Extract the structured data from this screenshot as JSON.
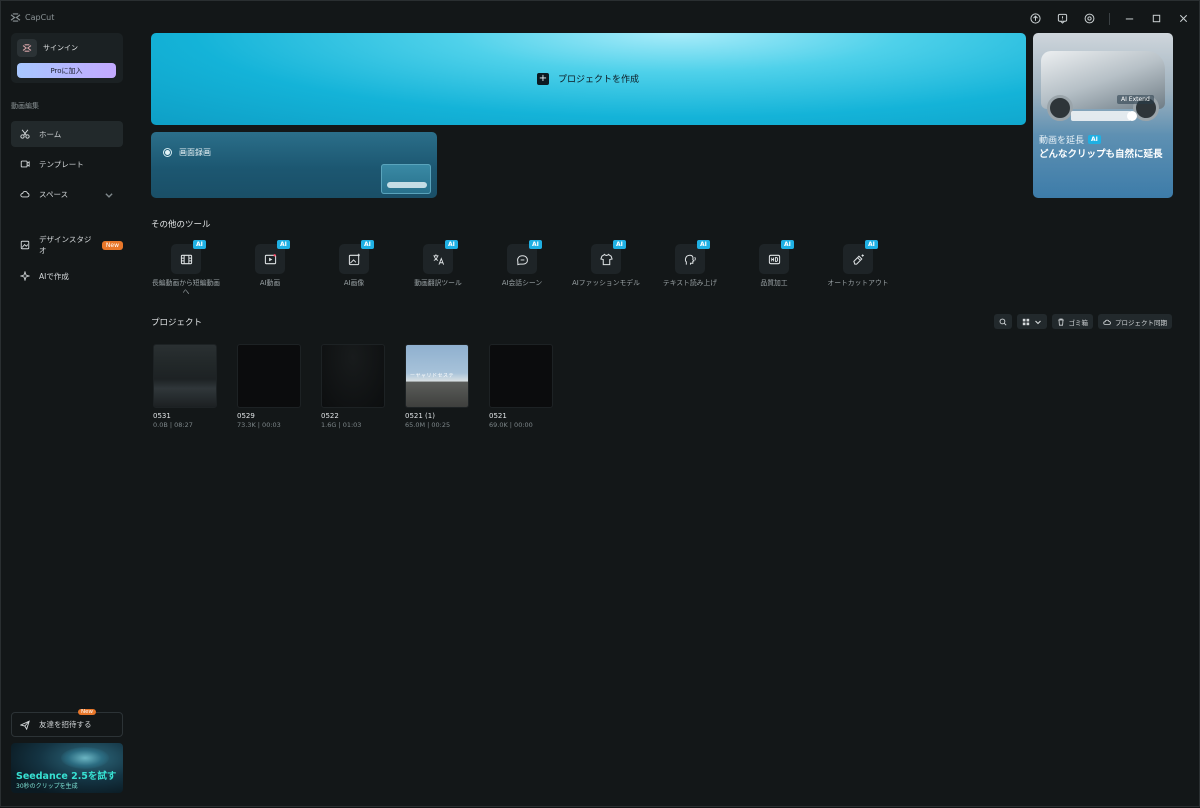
{
  "app": {
    "title": "CapCut"
  },
  "window_controls": [
    "upload-icon",
    "feedback-icon",
    "settings-icon",
    "minimize-icon",
    "maximize-icon",
    "close-icon"
  ],
  "sidebar": {
    "signin_label": "サインイン",
    "pro_button": "Proに加入",
    "section_label": "動画編集",
    "items": [
      {
        "label": "ホーム",
        "icon": "scissors-icon",
        "active": true
      },
      {
        "label": "テンプレート",
        "icon": "template-icon"
      },
      {
        "label": "スペース",
        "icon": "cloud-icon"
      },
      {
        "label": "デザインスタジオ",
        "icon": "design-icon",
        "badge": "New"
      },
      {
        "label": "AIで作成",
        "icon": "sparkle-icon"
      }
    ],
    "invite": {
      "label": "友達を招待する",
      "badge": "New"
    },
    "promo": {
      "title": "Seedance 2.5を試す",
      "subtitle": "30秒のクリップを生成"
    }
  },
  "hero": {
    "label": "プロジェクトを作成"
  },
  "record": {
    "label": "画面録画"
  },
  "side_card": {
    "tag": "AI Extend",
    "title": "動画を延長",
    "ai_badge": "AI",
    "subtitle": "どんなクリップも自然に延長"
  },
  "tools_heading": "その他のツール",
  "tools": [
    {
      "label": "長編動画から短編動画へ",
      "icon": "film-icon",
      "badge": "AI"
    },
    {
      "label": "AI動画",
      "icon": "video-icon",
      "badge": "AI"
    },
    {
      "label": "AI画像",
      "icon": "image-icon",
      "badge": "AI"
    },
    {
      "label": "動画翻訳ツール",
      "icon": "translate-icon",
      "badge": "AI"
    },
    {
      "label": "AI会話シーン",
      "icon": "chat-icon",
      "badge": "AI"
    },
    {
      "label": "AIファッションモデル",
      "icon": "shirt-icon",
      "badge": "AI"
    },
    {
      "label": "テキスト読み上げ",
      "icon": "voice-icon",
      "badge": "AI"
    },
    {
      "label": "品質加工",
      "icon": "hd-icon",
      "badge": "AI"
    },
    {
      "label": "オートカットアウト",
      "icon": "eraser-icon",
      "badge": "AI"
    }
  ],
  "projects_heading": "プロジェクト",
  "project_toolbar": {
    "trash": "ゴミ箱",
    "sync": "プロジェクト同期"
  },
  "projects": [
    {
      "name": "0531",
      "meta": "0.0B | 08:27"
    },
    {
      "name": "0529",
      "meta": "73.3K | 00:03"
    },
    {
      "name": "0522",
      "meta": "1.6G | 01:03"
    },
    {
      "name": "0521 (1)",
      "meta": "65.0M | 00:25",
      "thumb_caption": "ーヤャリドセステ"
    },
    {
      "name": "0521",
      "meta": "69.0K | 00:00"
    }
  ]
}
